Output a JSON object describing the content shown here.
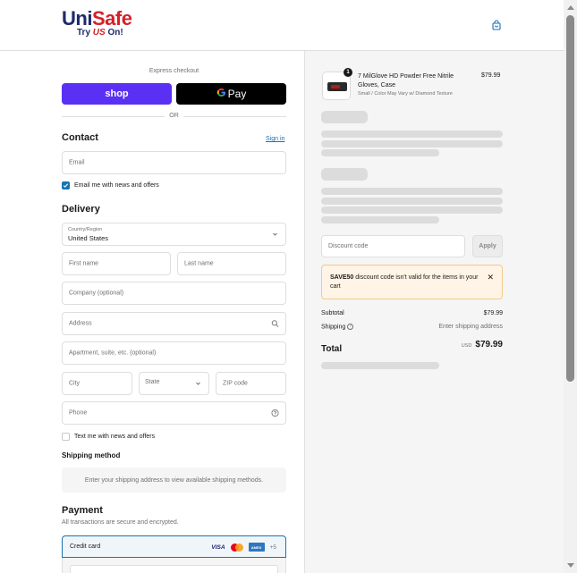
{
  "brand": {
    "name_part1": "Uni",
    "name_part2": "Safe",
    "tagline_start": "Try",
    "tagline_us": "US",
    "tagline_end": "On!"
  },
  "express": {
    "label": "Express checkout",
    "shop_label": "shop",
    "gpay_label": "Pay",
    "or_label": "OR"
  },
  "contact": {
    "title": "Contact",
    "signin_label": "Sign in",
    "email_placeholder": "Email",
    "news_label": "Email me with news and offers",
    "news_checked": true
  },
  "delivery": {
    "title": "Delivery",
    "country_label": "Country/Region",
    "country_value": "United States",
    "first_name_placeholder": "First name",
    "last_name_placeholder": "Last name",
    "company_placeholder": "Company (optional)",
    "address_placeholder": "Address",
    "apartment_placeholder": "Apartment, suite, etc. (optional)",
    "city_placeholder": "City",
    "state_label": "State",
    "zip_placeholder": "ZIP code",
    "phone_placeholder": "Phone",
    "text_label": "Text me with news and offers",
    "text_checked": false
  },
  "shipping": {
    "title": "Shipping method",
    "message": "Enter your shipping address to view available shipping methods."
  },
  "payment": {
    "title": "Payment",
    "subtitle": "All transactions are secure and encrypted.",
    "method_label": "Credit card",
    "visa": "VISA",
    "amex": "AMEX",
    "more": "+5"
  },
  "order": {
    "product": {
      "quantity": "1",
      "title": "7 MilGlove HD Powder Free Nitrile Gloves, Case",
      "variant": "Small / Color May Vary w/ Diamond Texture",
      "price": "$79.99"
    },
    "discount_placeholder": "Discount code",
    "apply_label": "Apply",
    "alert_code": "SAVE50",
    "alert_text": " discount code isn't valid for the items in your cart",
    "subtotal_label": "Subtotal",
    "subtotal_value": "$79.99",
    "shipping_label": "Shipping",
    "shipping_value": "Enter shipping address",
    "total_label": "Total",
    "currency": "USD",
    "total_value": "$79.99"
  },
  "colors": {
    "shop_purple": "#5a31f4",
    "link_blue": "#1773b0",
    "brand_navy": "#1d2a6b",
    "brand_red": "#d62027",
    "alert_bg": "#fff4e5"
  }
}
